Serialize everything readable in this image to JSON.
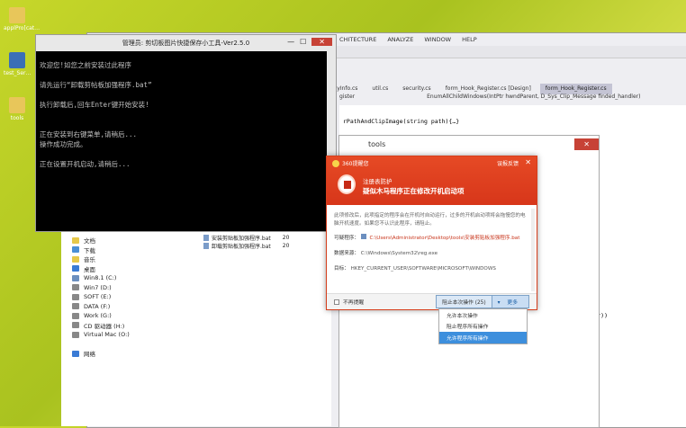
{
  "desktop": {
    "icons": [
      {
        "label": "applPro[cat…"
      },
      {
        "label": "test_Ser…"
      },
      {
        "label": "tools"
      }
    ]
  },
  "vs": {
    "menu": [
      "CHITECTURE",
      "ANALYZE",
      "WINDOW",
      "HELP"
    ],
    "tabs": [
      "nblyInfo.cs",
      "util.cs",
      "security.cs",
      "form_Hook_Register.cs [Design]",
      "form_Hook_Register.cs"
    ],
    "navbar": [
      "gister",
      "EnumAllChildWindows(IntPtr hwndParent, D_Sys_Clip_Message finded_handler)"
    ],
    "code_line1": "rPathAndClipImage(string path){…}",
    "code_line2": "r))"
  },
  "cmd": {
    "title": "管理员:  剪切板图片快捷保存小工具-Ver2.5.0",
    "lines": [
      "欢迎您!如您之前安装过此程序",
      "",
      "请先运行“卸载剪帖板加强程序.bat”",
      "",
      "执行卸载后,回车Enter键开始安装!",
      "",
      "",
      "正在安装到右键菜单,请稍后...",
      "操作成功完成。",
      "",
      "正在设置开机启动,请稍后..."
    ]
  },
  "explorer": {
    "nav": [
      {
        "label": "文档",
        "icon": "document-folder-icon",
        "color": "#e6c84a"
      },
      {
        "label": "下载",
        "icon": "download-folder-icon",
        "color": "#4a8fd6"
      },
      {
        "label": "音乐",
        "icon": "music-folder-icon",
        "color": "#e6c84a"
      },
      {
        "label": "桌面",
        "icon": "desktop-folder-icon",
        "color": "#3a7bd5"
      },
      {
        "label": "Win8.1 (C:)",
        "icon": "drive-icon",
        "color": "#6b8fbf"
      },
      {
        "label": "Win7 (D:)",
        "icon": "drive-icon",
        "color": "#888888"
      },
      {
        "label": "SOFT (E:)",
        "icon": "drive-icon",
        "color": "#888888"
      },
      {
        "label": "DATA (F:)",
        "icon": "drive-icon",
        "color": "#888888"
      },
      {
        "label": "Work (G:)",
        "icon": "drive-icon",
        "color": "#888888"
      },
      {
        "label": "CD 驱动器 (H:)",
        "icon": "cd-drive-icon",
        "color": "#888888"
      },
      {
        "label": "Virtual Mac (O:)",
        "icon": "drive-icon",
        "color": "#888888"
      },
      {
        "label": "",
        "icon": "",
        "color": ""
      },
      {
        "label": "网络",
        "icon": "network-icon",
        "color": "#3a7bd5"
      }
    ],
    "files": [
      {
        "name": "安装剪贴板加强程序.bat",
        "suffix": "20"
      },
      {
        "name": "卸载剪贴板加强程序.bat",
        "suffix": "20"
      }
    ]
  },
  "tools": {
    "title": "tools"
  },
  "popup": {
    "brand": "360提醒您",
    "feedback": "误报反馈",
    "close": "✕",
    "header_small": "注册表防护",
    "header_big": "疑似木马程序正在修改开机启动项",
    "description": "此项修改后，此项指定的程序会在开机时自动运行，过多的开机启动项将会拖慢您的电脑开机速度。如果您不认识此程序，请阻止。",
    "program_label": "可疑程序：",
    "program_value": "C:\\Users\\Administrator\\Desktop\\tools\\安装剪贴板加强程序.bat",
    "source_label": "数据来源：",
    "source_value": "C:\\Windows\\System32\\reg.exe",
    "target_label": "目标：",
    "target_value": "HKEY_CURRENT_USER\\SOFTWARE\\MICROSOFT\\WINDOWS",
    "no_remind": "不再提醒",
    "main_button": "阻止本次操作 (25)",
    "more_button": "更多",
    "accent": "#d7361a"
  },
  "dropdown": {
    "options": [
      "允许本次操作",
      "阻止程序所有操作",
      "允许程序所有操作"
    ],
    "selected_index": 2
  }
}
